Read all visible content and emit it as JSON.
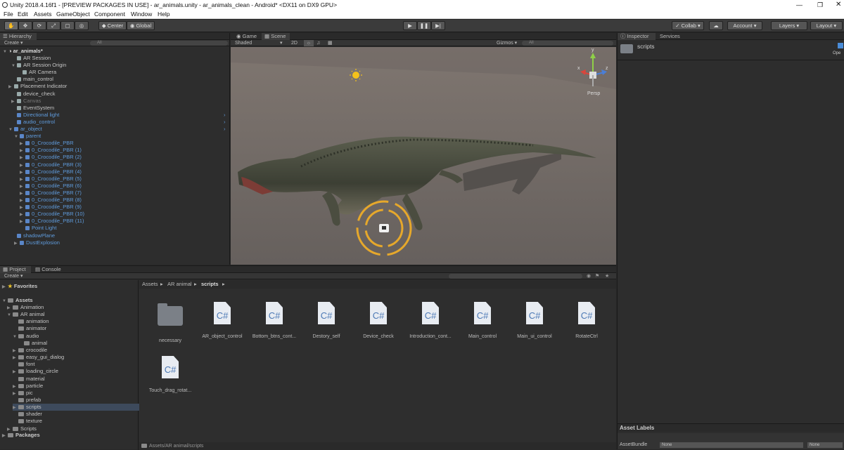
{
  "window": {
    "title": "Unity 2018.4.16f1 - [PREVIEW PACKAGES IN USE] - ar_animals.unity - ar_animals_clean - Android* <DX11 on DX9 GPU>"
  },
  "menu": [
    "File",
    "Edit",
    "Assets",
    "GameObject",
    "Component",
    "Window",
    "Help"
  ],
  "toolbar": {
    "center_label": "Center",
    "global_label": "Global",
    "collab_label": "Collab",
    "account_label": "Account",
    "layers_label": "Layers",
    "layout_label": "Layout"
  },
  "hierarchy": {
    "tab": "Hierarchy",
    "create": "Create",
    "search_placeholder": "All",
    "scene_name": "ar_animals*",
    "items": [
      {
        "label": "AR Session"
      },
      {
        "label": "AR Session Origin"
      },
      {
        "label": "AR Camera"
      },
      {
        "label": "main_control"
      },
      {
        "label": "Placement Indicator"
      },
      {
        "label": "device_check"
      },
      {
        "label": "Canvas"
      },
      {
        "label": "EventSystem"
      },
      {
        "label": "Directional light"
      },
      {
        "label": "audio_control"
      },
      {
        "label": "ar_object"
      },
      {
        "label": "parent"
      },
      {
        "label": "0_Crocodile_PBR"
      },
      {
        "label": "0_Crocodile_PBR (1)"
      },
      {
        "label": "0_Crocodile_PBR (2)"
      },
      {
        "label": "0_Crocodile_PBR (3)"
      },
      {
        "label": "0_Crocodile_PBR (4)"
      },
      {
        "label": "0_Crocodile_PBR (5)"
      },
      {
        "label": "0_Crocodile_PBR (6)"
      },
      {
        "label": "0_Crocodile_PBR (7)"
      },
      {
        "label": "0_Crocodile_PBR (8)"
      },
      {
        "label": "0_Crocodile_PBR (9)"
      },
      {
        "label": "0_Crocodile_PBR (10)"
      },
      {
        "label": "0_Crocodile_PBR (11)"
      },
      {
        "label": "Point Light"
      },
      {
        "label": "shadowPlane"
      },
      {
        "label": "DustExplosion"
      }
    ]
  },
  "scene": {
    "tab_game": "Game",
    "tab_scene": "Scene",
    "shaded": "Shaded",
    "mode_2d": "2D",
    "gizmos": "Gizmos",
    "search_placeholder": "All",
    "persp": "Persp",
    "axis_x": "x",
    "axis_y": "y",
    "axis_z": "z"
  },
  "inspector": {
    "tab_inspector": "Inspector",
    "tab_services": "Services",
    "object_name": "scripts",
    "open_label": "Ope",
    "asset_labels": "Asset Labels",
    "asset_bundle": "AssetBundle",
    "bundle_value": "None",
    "variant_value": "None"
  },
  "project": {
    "tab_project": "Project",
    "tab_console": "Console",
    "create": "Create",
    "favorites": "Favorites",
    "assets": "Assets",
    "breadcrumb": [
      "Assets",
      "AR animal",
      "scripts"
    ],
    "tree": [
      {
        "label": "Animation"
      },
      {
        "label": "AR animal"
      },
      {
        "label": "animation"
      },
      {
        "label": "animator"
      },
      {
        "label": "audio"
      },
      {
        "label": "animal"
      },
      {
        "label": "crocodile"
      },
      {
        "label": "easy_gui_dialog"
      },
      {
        "label": "font"
      },
      {
        "label": "loading_circle"
      },
      {
        "label": "material"
      },
      {
        "label": "particle"
      },
      {
        "label": "pic"
      },
      {
        "label": "prefab"
      },
      {
        "label": "scripts"
      },
      {
        "label": "shader"
      },
      {
        "label": "texture"
      },
      {
        "label": "Scripts"
      }
    ],
    "packages": "Packages",
    "files": [
      {
        "label": "necessary",
        "type": "folder"
      },
      {
        "label": "AR_object_control",
        "type": "cs"
      },
      {
        "label": "Bottom_btns_cont...",
        "type": "cs"
      },
      {
        "label": "Destory_self",
        "type": "cs"
      },
      {
        "label": "Device_check",
        "type": "cs"
      },
      {
        "label": "Introduction_cont...",
        "type": "cs"
      },
      {
        "label": "Main_control",
        "type": "cs"
      },
      {
        "label": "Main_ui_control",
        "type": "cs"
      },
      {
        "label": "RotateCtrl",
        "type": "cs"
      },
      {
        "label": "Touch_drag_rotat...",
        "type": "cs"
      }
    ],
    "cs_glyph": "C#",
    "status_path": "Assets/AR animal/scripts"
  }
}
